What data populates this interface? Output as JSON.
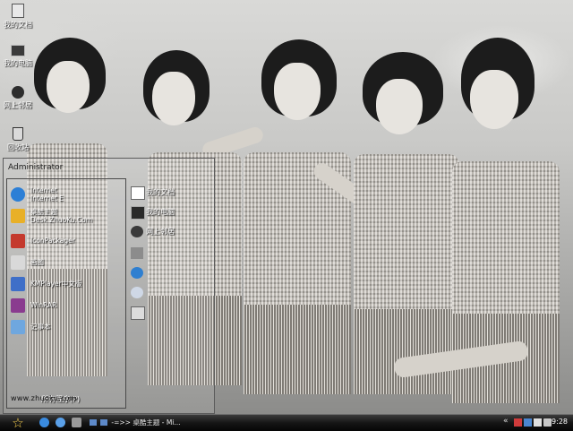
{
  "desktop": {
    "icons": [
      {
        "label": "我的文档",
        "icon": "documents-folder-icon",
        "color": "#e8e8e8"
      },
      {
        "label": "我的电脑",
        "icon": "computer-icon",
        "color": "#3a3a3a"
      },
      {
        "label": "网上邻居",
        "icon": "network-icon",
        "color": "#2d2d2d"
      },
      {
        "label": "回收站",
        "icon": "recycle-bin-icon",
        "color": "#dadada"
      }
    ]
  },
  "start_menu": {
    "user": "Administrator",
    "pinned": [
      {
        "line1": "Internet",
        "line2": "Internet E",
        "icon": "internet-explorer-icon",
        "color": "#2c7fd6"
      },
      {
        "line1": "桌酷主题",
        "line2": "Desk.ZhuoKu.Com",
        "icon": "zhuoku-theme-icon",
        "color": "#e8b028"
      }
    ],
    "recent": [
      {
        "label": "IconPackager",
        "icon": "iconpackager-icon",
        "color": "#c43a2e"
      },
      {
        "label": "画图",
        "icon": "paint-icon",
        "color": "#d9d9d9"
      },
      {
        "label": "KMPlayer中文版",
        "icon": "kmplayer-icon",
        "color": "#3f6fc8"
      },
      {
        "label": "WinRAR",
        "icon": "winrar-icon",
        "color": "#8a3b8f"
      },
      {
        "label": "记事本",
        "icon": "notepad-icon",
        "color": "#6fa7df"
      }
    ],
    "all_programs": "所有程序(P)",
    "right": [
      {
        "label": "我的文档",
        "icon": "my-documents-icon",
        "color": "#ffffff"
      },
      {
        "label": "我的电脑",
        "icon": "my-computer-icon",
        "color": "#2a2a2a"
      },
      {
        "label": "网上邻居",
        "icon": "network-places-icon",
        "color": "#3a3a3a"
      },
      {
        "label": "",
        "icon": "control-panel-icon",
        "color": "#8c8c8c"
      },
      {
        "label": "",
        "icon": "help-icon",
        "color": "#2f7fd0"
      },
      {
        "label": "",
        "icon": "search-icon",
        "color": "#cfd8e6"
      },
      {
        "label": "",
        "icon": "run-icon",
        "color": "#dcdcdc"
      }
    ]
  },
  "watermark": "www.zhuoku.com",
  "taskbar": {
    "quick_launch": [
      {
        "icon": "ie-quicklaunch-icon",
        "color": "#3a8be0"
      },
      {
        "icon": "ie-alt-quicklaunch-icon",
        "color": "#5aa0e8"
      },
      {
        "icon": "show-desktop-icon",
        "color": "#9a9a9a"
      }
    ],
    "tasks": [
      {
        "label": "-=>>",
        "icon": "task-window-icon",
        "color": "#5d89c9"
      },
      {
        "label": "桌酷主题 - Mi...",
        "icon": "task-window-icon-2",
        "color": "#5d89c9"
      }
    ],
    "tray_arrow": "«",
    "tray_icons": [
      {
        "icon": "tray-icon-1",
        "color": "#cf3b3b"
      },
      {
        "icon": "tray-icon-2",
        "color": "#4a86d0"
      },
      {
        "icon": "tray-icon-3",
        "color": "#e0e0e0"
      },
      {
        "icon": "volume-icon",
        "color": "#c8c8c8"
      }
    ],
    "clock": "9:28"
  }
}
